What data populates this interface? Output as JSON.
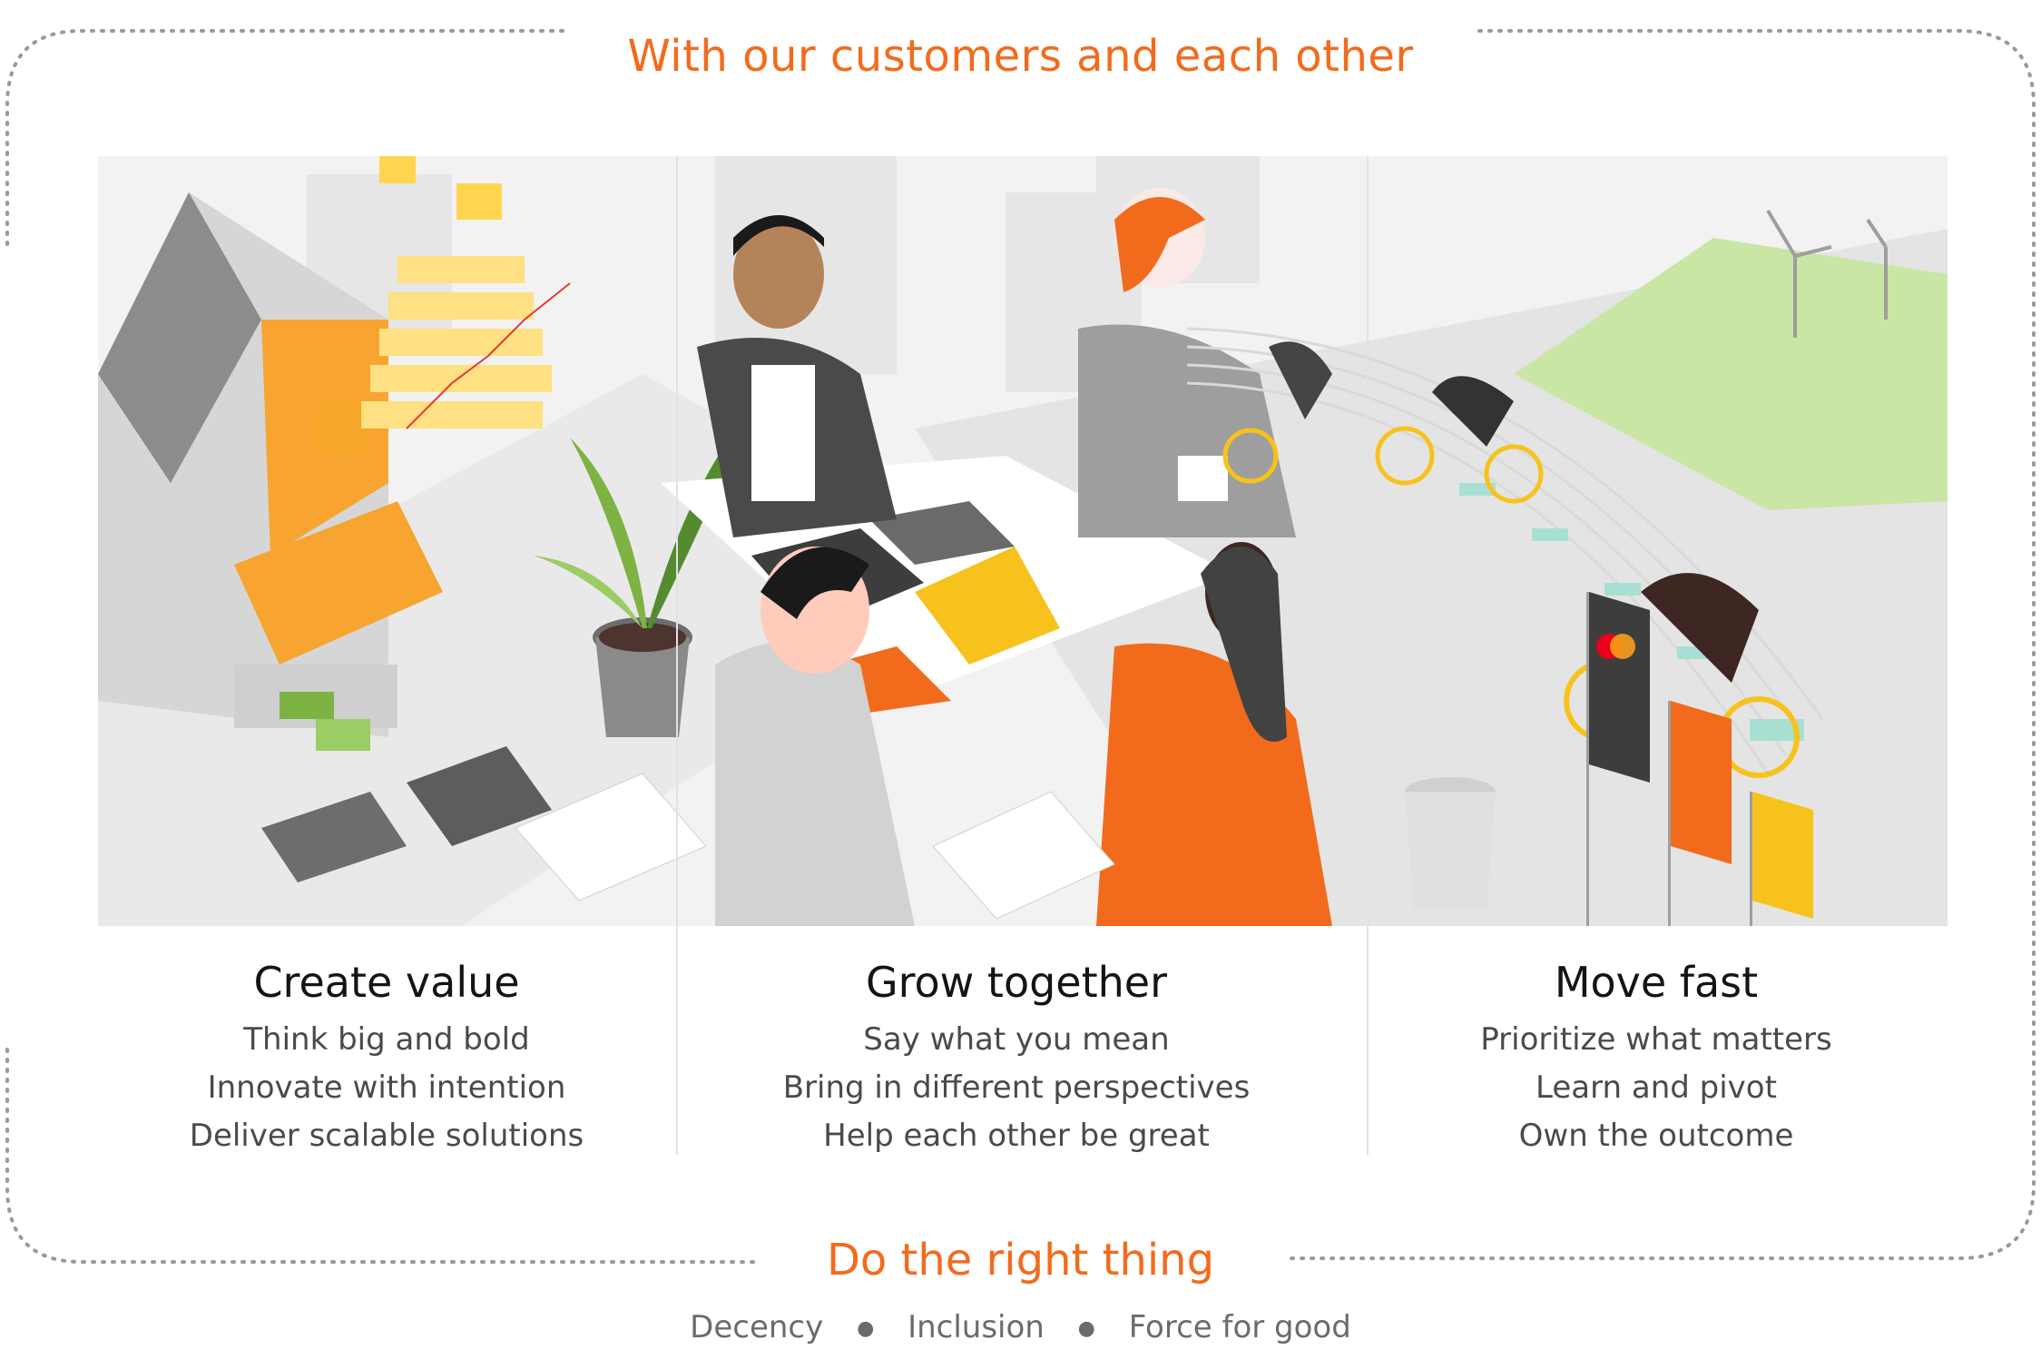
{
  "header": {
    "title": "With our customers and each other"
  },
  "columns": [
    {
      "heading": "Create value",
      "items": [
        "Think big and bold",
        "Innovate with intention",
        "Deliver scalable solutions"
      ]
    },
    {
      "heading": "Grow together",
      "items": [
        "Say what you mean",
        "Bring in different perspectives",
        "Help each other be great"
      ]
    },
    {
      "heading": "Move fast",
      "items": [
        "Prioritize what matters",
        "Learn and pivot",
        "Own the outcome"
      ]
    }
  ],
  "footer": {
    "title": "Do the right thing",
    "principles": [
      "Decency",
      "Inclusion",
      "Force for good"
    ]
  },
  "colors": {
    "accent_orange": "#f26b1d",
    "accent_yellow": "#f7c21b",
    "accent_teal": "#5ec4b0",
    "leaf_green": "#7cb342",
    "neutral_gray": "#bdbdbd"
  }
}
